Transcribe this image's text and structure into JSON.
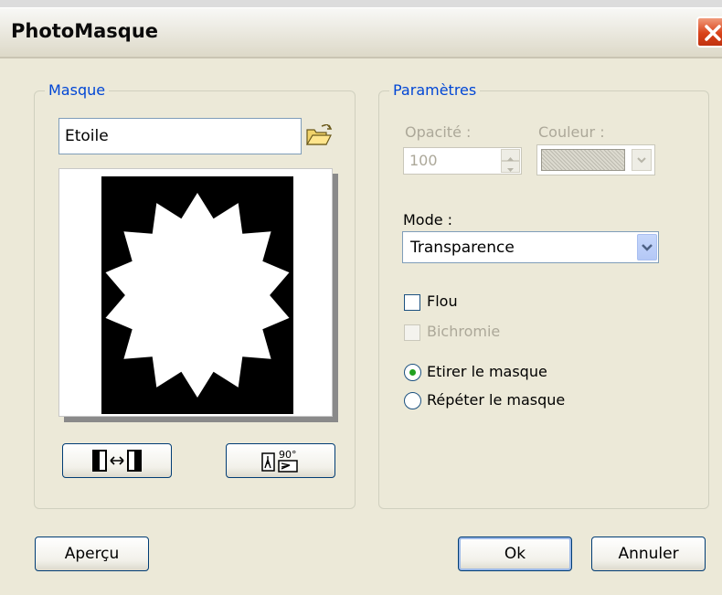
{
  "window": {
    "title": "PhotoMasque",
    "close_icon": "close-icon"
  },
  "masque": {
    "legend": "Masque",
    "name_value": "Etoile",
    "browse_icon": "open-folder-icon",
    "preview_shape": "star",
    "flip_icon": "flip-horizontal-icon",
    "rotate_icon": "rotate-90-icon",
    "rotate_label": "90°"
  },
  "parametres": {
    "legend": "Paramètres",
    "opacity_label": "Opacité :",
    "opacity_value": "100",
    "color_label": "Couleur :",
    "mode_label": "Mode :",
    "mode_value": "Transparence",
    "flou_label": "Flou",
    "flou_checked": false,
    "bichromie_label": "Bichromie",
    "bichromie_checked": false,
    "bichromie_enabled": false,
    "radio_stretch_label": "Etirer le masque",
    "radio_repeat_label": "Répéter le masque",
    "selected_radio": "Etirer le masque"
  },
  "buttons": {
    "preview_label": "Aperçu",
    "ok_label": "Ok",
    "cancel_label": "Annuler"
  },
  "colors": {
    "legend_text": "#0046d5",
    "disabled_text": "#aca899",
    "close_button": "#d9431a",
    "radio_dot": "#21a121"
  }
}
